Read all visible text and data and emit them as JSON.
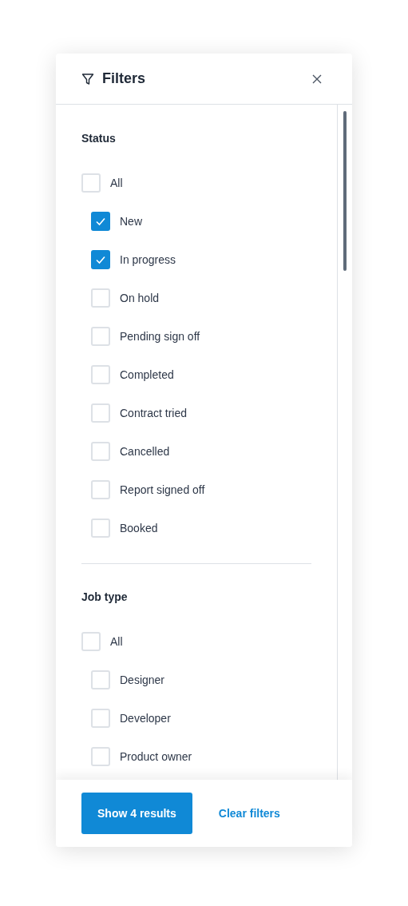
{
  "panel": {
    "title": "Filters"
  },
  "sections": [
    {
      "title": "Status",
      "all": {
        "label": "All",
        "checked": false,
        "children": [
          {
            "label": "New",
            "checked": true
          },
          {
            "label": "In progress",
            "checked": true
          },
          {
            "label": "On hold",
            "checked": false
          },
          {
            "label": "Pending sign off",
            "checked": false
          },
          {
            "label": "Completed",
            "checked": false
          },
          {
            "label": "Contract tried",
            "checked": false
          },
          {
            "label": "Cancelled",
            "checked": false
          },
          {
            "label": "Report signed off",
            "checked": false
          },
          {
            "label": "Booked",
            "checked": false
          }
        ]
      }
    },
    {
      "title": "Job type",
      "all": {
        "label": "All",
        "checked": false,
        "children": [
          {
            "label": "Designer",
            "checked": false
          },
          {
            "label": "Developer",
            "checked": false
          },
          {
            "label": "Product owner",
            "checked": false
          }
        ]
      }
    }
  ],
  "footer": {
    "primary": "Show 4 results",
    "secondary": "Clear filters"
  }
}
